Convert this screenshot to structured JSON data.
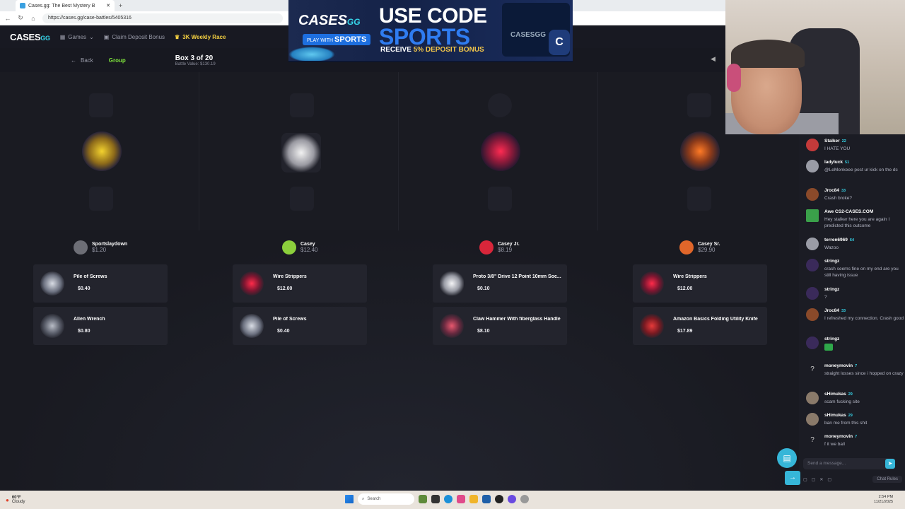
{
  "browser": {
    "tab_title": "Cases.gg: The Best Mystery B",
    "url": "https://cases.gg/case-battles/5405316"
  },
  "site": {
    "logo": "CASES",
    "logo_suffix": "GG",
    "nav": {
      "games": "Games",
      "claim": "Claim Deposit Bonus",
      "race": "3K Weekly Race"
    }
  },
  "battle": {
    "back_label": "Back",
    "mode": "Group",
    "box_label": "Box 3 of 20",
    "battle_value": "Battle Value: $130.19"
  },
  "ad": {
    "brand": "CASES",
    "brand_suffix": "GG",
    "play_with": "PLAY WITH",
    "sports": "SPORTS",
    "headline1": "USE CODE",
    "headline2": "SPORTS",
    "subline_prefix": "RECEIVE ",
    "subline_highlight": "5% DEPOSIT BONUS",
    "box_logo": "CASESGG",
    "coin": "C"
  },
  "players": [
    {
      "name": "Sportslaydown",
      "value": "$1.20",
      "items": [
        {
          "name": "Pile of Screws",
          "price": "$0.40"
        },
        {
          "name": "Allen Wrench",
          "price": "$0.80"
        }
      ]
    },
    {
      "name": "Casey",
      "value": "$12.40",
      "items": [
        {
          "name": "Wire Strippers",
          "price": "$12.00"
        },
        {
          "name": "Pile of Screws",
          "price": "$0.40"
        }
      ]
    },
    {
      "name": "Casey Jr.",
      "value": "$8.19",
      "items": [
        {
          "name": "Proto 3/8\" Drive 12 Point 10mm Soc...",
          "price": "$0.10"
        },
        {
          "name": "Claw Hammer With fiberglass Handle",
          "price": "$8.10"
        }
      ]
    },
    {
      "name": "Casey Sr.",
      "value": "$29.90",
      "items": [
        {
          "name": "Wire Strippers",
          "price": "$12.00"
        },
        {
          "name": "Amazon Basics Folding Utility Knife",
          "price": "$17.89"
        }
      ]
    }
  ],
  "chat": {
    "messages": [
      {
        "user": "Stalker",
        "level": "22",
        "text": "I HATE YOU"
      },
      {
        "user": "ladyluck",
        "level": "51",
        "text": "@LeMonkeee post ur kick on the dc"
      },
      {
        "user": "Jroc84",
        "level": "33",
        "text": "Crash broke?"
      },
      {
        "user": "Awe CS2-CASES.COM",
        "level": "",
        "text": "Hey stalker here you are again I predicted this outcome"
      },
      {
        "user": "terren6969",
        "level": "64",
        "text": "Wazoo"
      },
      {
        "user": "stringz",
        "level": "",
        "text": "crash seems fine on my end are you still having issue"
      },
      {
        "user": "stringz",
        "level": "",
        "text": "?"
      },
      {
        "user": "Jroc84",
        "level": "33",
        "text": "I refreshed my connection. Crash good"
      },
      {
        "user": "stringz",
        "level": "",
        "text": ""
      },
      {
        "user": "moneymovin",
        "level": "7",
        "text": "straight losses since i hopped on crazy"
      },
      {
        "user": "sHimukas",
        "level": "29",
        "text": "scam fucking site"
      },
      {
        "user": "sHimukas",
        "level": "29",
        "text": "ban me from this shit"
      },
      {
        "user": "moneymovin",
        "level": "7",
        "text": "f it we ball"
      }
    ],
    "input_placeholder": "Send a message...",
    "rules_label": "Chat Rules"
  },
  "taskbar": {
    "temp": "60°F",
    "weather": "Cloudy",
    "search": "Search",
    "time": "2:54 PM",
    "date": "11/21/2025"
  },
  "colors": {
    "accent": "#36d3e8",
    "group_green": "#7ee33c",
    "race_yellow": "#f5d142",
    "button_blue": "#36b6d8"
  }
}
